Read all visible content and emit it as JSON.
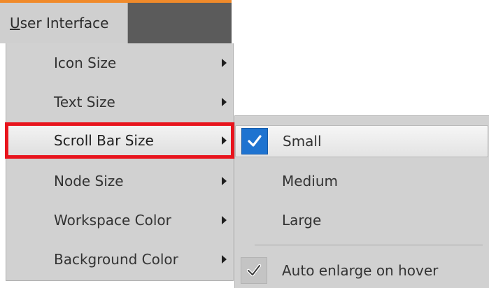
{
  "menubar": {
    "item_mnemonic": "U",
    "item_rest": "ser Interface"
  },
  "menu": {
    "items": [
      {
        "label": "Icon Size"
      },
      {
        "label": "Text Size"
      },
      {
        "label": "Scroll Bar Size"
      },
      {
        "label": "Node Size"
      },
      {
        "label": "Workspace Color"
      },
      {
        "label": "Background Color"
      }
    ]
  },
  "submenu": {
    "items": [
      {
        "label": "Small",
        "checked": true
      },
      {
        "label": "Medium",
        "checked": false
      },
      {
        "label": "Large",
        "checked": false
      },
      {
        "label": "Auto enlarge on hover",
        "checked": true
      }
    ]
  },
  "colors": {
    "accent_orange": "#f08a2a",
    "highlight_red": "#e8141d",
    "check_blue": "#1e73d0"
  },
  "icons": {
    "submenu_arrow": "chevron-right-icon",
    "check": "checkmark-icon"
  }
}
